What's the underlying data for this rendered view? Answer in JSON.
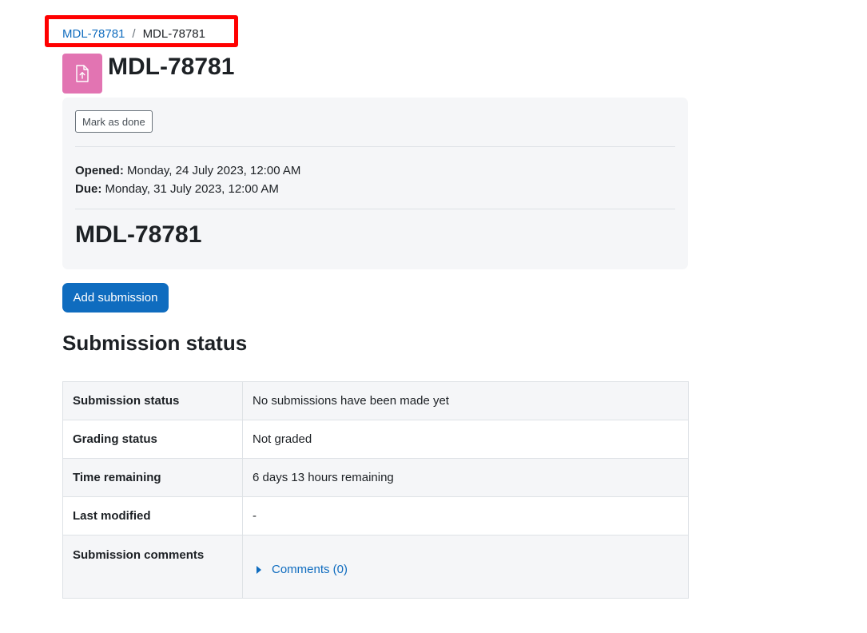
{
  "breadcrumb": {
    "link_label": "MDL-78781",
    "separator": "/",
    "current_label": "MDL-78781"
  },
  "header": {
    "title": "MDL-78781",
    "icon": "assignment-upload-icon",
    "icon_color": "#e274b2"
  },
  "activity": {
    "mark_done_label": "Mark as done",
    "opened_label": "Opened:",
    "opened_value": "Monday, 24 July 2023, 12:00 AM",
    "due_label": "Due:",
    "due_value": "Monday, 31 July 2023, 12:00 AM",
    "intro_title": "MDL-78781"
  },
  "actions": {
    "add_submission_label": "Add submission",
    "accent_color": "#0f6cbf"
  },
  "submission_status": {
    "heading": "Submission status",
    "rows": [
      {
        "label": "Submission status",
        "value": "No submissions have been made yet"
      },
      {
        "label": "Grading status",
        "value": "Not graded"
      },
      {
        "label": "Time remaining",
        "value": "6 days 13 hours remaining"
      },
      {
        "label": "Last modified",
        "value": "-"
      },
      {
        "label": "Submission comments",
        "value": "Comments (0)"
      }
    ]
  }
}
